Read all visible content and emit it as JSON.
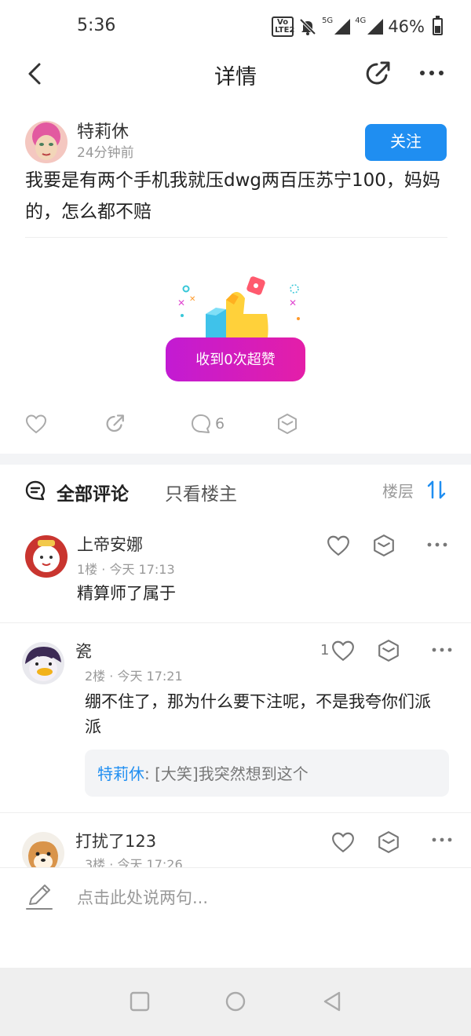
{
  "status": {
    "time": "5:36",
    "volte": "Vo LTE2",
    "network_1": "5G",
    "network_2": "4G",
    "battery": "46%"
  },
  "header": {
    "title": "详情",
    "back_icon": "back-arrow-icon",
    "share_icon": "share-icon",
    "more_icon": "more-icon"
  },
  "post": {
    "author": "特莉休",
    "time_ago": "24分钟前",
    "follow_label": "关注",
    "text": "我要是有两个手机我就压dwg两百压苏宁100，妈妈的，怎么都不赔",
    "superlike_label": "收到0次超赞",
    "comment_count": "6"
  },
  "comments_header": {
    "all_label": "全部评论",
    "owner_only_label": "只看楼主",
    "sort_label": "楼层"
  },
  "comments": [
    {
      "name": "上帝安娜",
      "meta": "1楼 · 今天 17:13",
      "text": "精算师了属于",
      "likes": ""
    },
    {
      "name": "瓷",
      "meta": "2楼 · 今天 17:21",
      "text": "绷不住了，那为什么要下注呢，不是我夸你们派派",
      "likes": "1",
      "reply": {
        "author": "特莉休",
        "separator": ": ",
        "text": "[大笑]我突然想到这个"
      }
    },
    {
      "name": "打扰了123",
      "meta": "3楼 · 今天 17:26",
      "text": "",
      "likes": ""
    }
  ],
  "input": {
    "placeholder": "点击此处说两句..."
  },
  "colors": {
    "accent": "#1f8ef1",
    "superlike_gradient_start": "#c21bd3",
    "superlike_gradient_end": "#e41ea8"
  }
}
